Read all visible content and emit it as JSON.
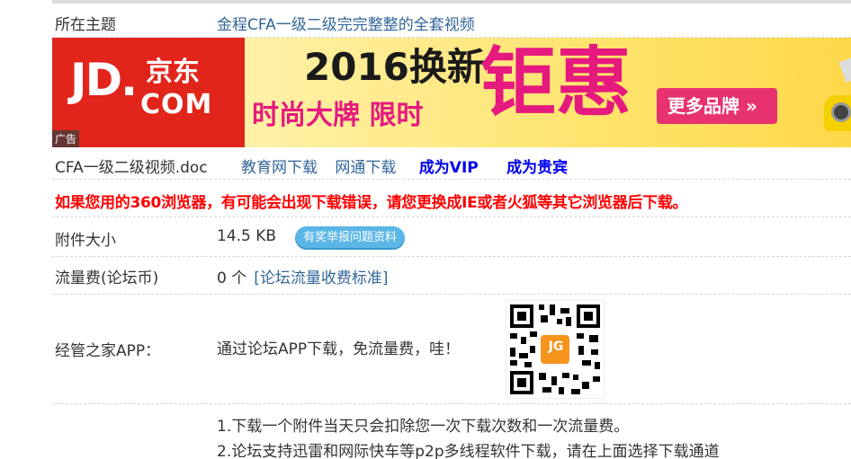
{
  "topic": {
    "label": "所在主题",
    "value": "金程CFA一级二级完完整整的全套视频"
  },
  "banner": {
    "brand_logo": "JD.",
    "brand_cn": "京东",
    "brand_com": "COM",
    "ad_tag": "广告",
    "headline": "2016换新",
    "subline": "时尚大牌  限时",
    "big_text": "钜惠",
    "button": "更多品牌 »",
    "colors": {
      "brand_red": "#e1251b",
      "accent_pink": "#e6197f"
    }
  },
  "file": {
    "name": "CFA一级二级视频.doc",
    "links": [
      "教育网下载",
      "网通下载"
    ],
    "vip": "成为VIP",
    "guest": "成为贵宾"
  },
  "warning": "如果您用的360浏览器，有可能会出现下载错误，请您更换成IE或者火狐等其它浏览器后下载。",
  "size": {
    "label": "附件大小",
    "value": "14.5 KB",
    "report": "有奖举报问题资料"
  },
  "fee": {
    "label": "流量费(论坛币)",
    "value": "0 个",
    "rule_link": "[论坛流量收费标准]"
  },
  "app": {
    "label": "经管之家APP：",
    "value": "通过论坛APP下载，免流量费，哇！",
    "qr_logo": "JG"
  },
  "notes": [
    "1.下载一个附件当天只会扣除您一次下载次数和一次流量费。",
    "2.论坛支持迅雷和网际快车等p2p多线程软件下载，请在上面选择下载通道"
  ]
}
